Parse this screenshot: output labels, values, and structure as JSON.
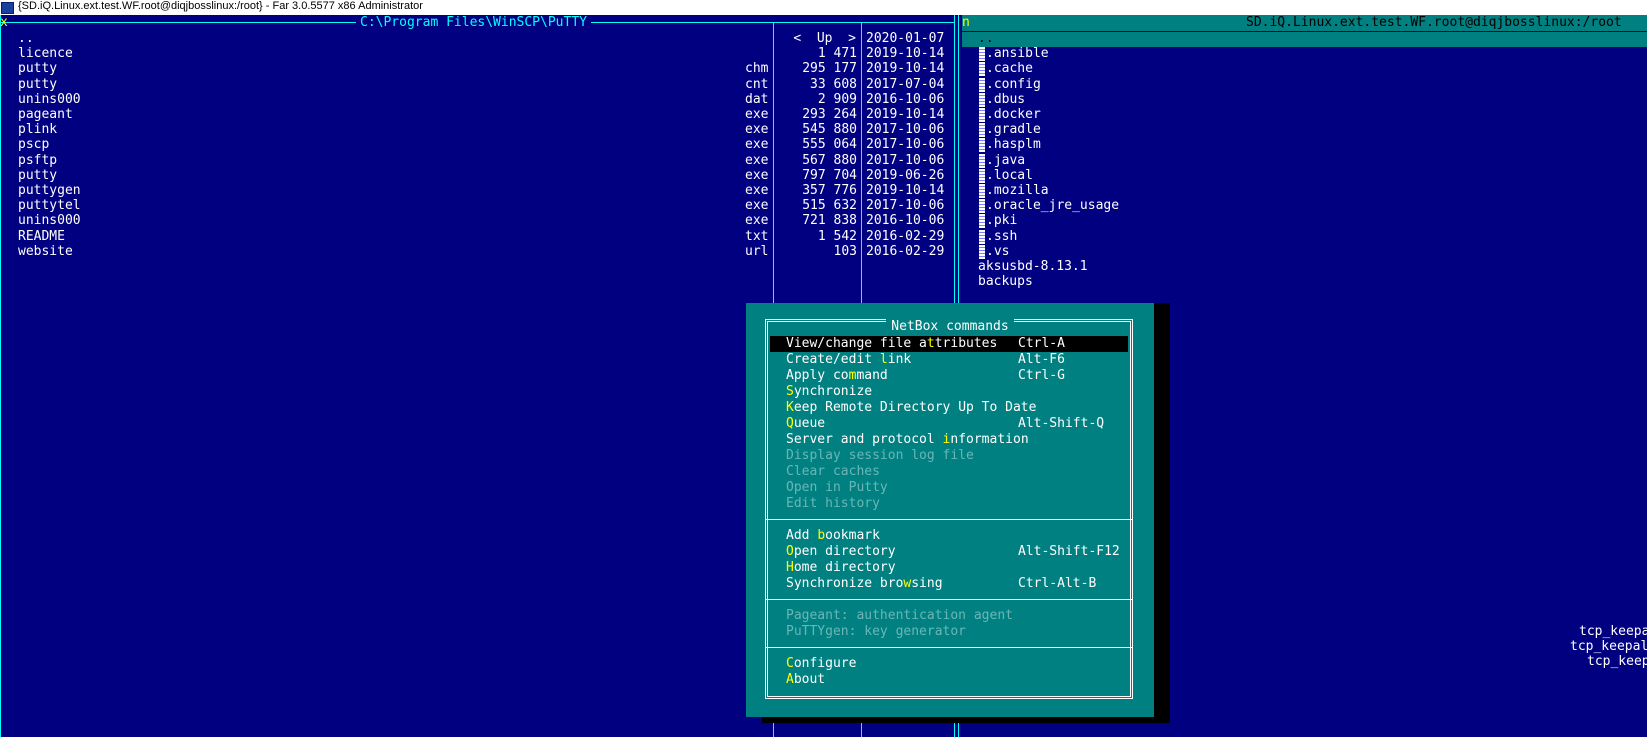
{
  "window": {
    "title": "{SD.iQ.Linux.ext.test.WF.root@diqjbosslinux:/root} - Far 3.0.5577 x86 Administrator"
  },
  "left_panel": {
    "corner_mark": "x",
    "path": "C:\\Program Files\\WinSCP\\PuTTY",
    "up_entry": {
      "name": "..",
      "size": "<  Up  >",
      "date": "2020-01-07"
    },
    "files": [
      {
        "name": "licence",
        "ext": "",
        "size": "1 471",
        "date": "2019-10-14"
      },
      {
        "name": "putty",
        "ext": "chm",
        "size": "295 177",
        "date": "2019-10-14"
      },
      {
        "name": "putty",
        "ext": "cnt",
        "size": "33 608",
        "date": "2017-07-04"
      },
      {
        "name": "unins000",
        "ext": "dat",
        "size": "2 909",
        "date": "2016-10-06"
      },
      {
        "name": "pageant",
        "ext": "exe",
        "size": "293 264",
        "date": "2019-10-14"
      },
      {
        "name": "plink",
        "ext": "exe",
        "size": "545 880",
        "date": "2017-10-06"
      },
      {
        "name": "pscp",
        "ext": "exe",
        "size": "555 064",
        "date": "2017-10-06"
      },
      {
        "name": "psftp",
        "ext": "exe",
        "size": "567 880",
        "date": "2017-10-06"
      },
      {
        "name": "putty",
        "ext": "exe",
        "size": "797 704",
        "date": "2019-06-26"
      },
      {
        "name": "puttygen",
        "ext": "exe",
        "size": "357 776",
        "date": "2019-10-14"
      },
      {
        "name": "puttytel",
        "ext": "exe",
        "size": "515 632",
        "date": "2017-10-06"
      },
      {
        "name": "unins000",
        "ext": "exe",
        "size": "721 838",
        "date": "2016-10-06"
      },
      {
        "name": "README",
        "ext": "txt",
        "size": "1 542",
        "date": "2016-02-29"
      },
      {
        "name": "website",
        "ext": "url",
        "size": "103",
        "date": "2016-02-29"
      }
    ]
  },
  "right_panel": {
    "corner_mark": "n",
    "title": "SD.iQ.Linux.ext.test.WF.root@diqjbosslinux:/root",
    "up_entry": "..",
    "files": [
      {
        "name": ".ansible",
        "dotfile": true
      },
      {
        "name": ".cache",
        "dotfile": true
      },
      {
        "name": ".config",
        "dotfile": true
      },
      {
        "name": ".dbus",
        "dotfile": true
      },
      {
        "name": ".docker",
        "dotfile": true
      },
      {
        "name": ".gradle",
        "dotfile": true
      },
      {
        "name": ".hasplm",
        "dotfile": true
      },
      {
        "name": ".java",
        "dotfile": true
      },
      {
        "name": ".local",
        "dotfile": true
      },
      {
        "name": ".mozilla",
        "dotfile": true
      },
      {
        "name": ".oracle_jre_usage",
        "dotfile": true
      },
      {
        "name": ".pki",
        "dotfile": true
      },
      {
        "name": ".ssh",
        "dotfile": true
      },
      {
        "name": ".vs",
        "dotfile": true
      },
      {
        "name": "aksusbd-8.13.1",
        "dotfile": false
      },
      {
        "name": "backups",
        "dotfile": false
      }
    ],
    "partial_items": [
      "tcp_keepa",
      "tcp_keepal",
      "tcp_keep"
    ]
  },
  "dialog": {
    "title": "NetBox commands",
    "groups": [
      [
        {
          "pre": "View/change file a",
          "hk": "t",
          "post": "tributes",
          "shortcut": "Ctrl-A",
          "selected": true
        },
        {
          "pre": "Create/edit ",
          "hk": "l",
          "post": "ink",
          "shortcut": "Alt-F6"
        },
        {
          "pre": "Apply co",
          "hk": "m",
          "post": "mand",
          "shortcut": "Ctrl-G"
        },
        {
          "pre": "",
          "hk": "S",
          "post": "ynchronize",
          "shortcut": ""
        },
        {
          "pre": "",
          "hk": "K",
          "post": "eep Remote Directory Up To Date",
          "shortcut": ""
        },
        {
          "pre": "",
          "hk": "Q",
          "post": "ueue",
          "shortcut": "Alt-Shift-Q"
        },
        {
          "pre": "Server and protocol ",
          "hk": "i",
          "post": "nformation",
          "shortcut": ""
        },
        {
          "pre": "Display session log file",
          "hk": "",
          "post": "",
          "shortcut": "",
          "disabled": true
        },
        {
          "pre": "Clear caches",
          "hk": "",
          "post": "",
          "shortcut": "",
          "disabled": true
        },
        {
          "pre": "Open in Putty",
          "hk": "",
          "post": "",
          "shortcut": "",
          "disabled": true
        },
        {
          "pre": "Edit history",
          "hk": "",
          "post": "",
          "shortcut": "",
          "disabled": true
        }
      ],
      [
        {
          "pre": "Add ",
          "hk": "b",
          "post": "ookmark",
          "shortcut": ""
        },
        {
          "pre": "",
          "hk": "O",
          "post": "pen directory",
          "shortcut": "Alt-Shift-F12"
        },
        {
          "pre": "",
          "hk": "H",
          "post": "ome directory",
          "shortcut": ""
        },
        {
          "pre": "Synchronize bro",
          "hk": "w",
          "post": "sing",
          "shortcut": "Ctrl-Alt-B"
        }
      ],
      [
        {
          "pre": "Pageant: authentication agent",
          "hk": "",
          "post": "",
          "shortcut": "",
          "disabled": true
        },
        {
          "pre": "PuTTYgen: key generator",
          "hk": "",
          "post": "",
          "shortcut": "",
          "disabled": true
        }
      ],
      [
        {
          "pre": "",
          "hk": "C",
          "post": "onfigure",
          "shortcut": ""
        },
        {
          "pre": "",
          "hk": "A",
          "post": "bout",
          "shortcut": ""
        }
      ]
    ]
  },
  "colors": {
    "background": "#000080",
    "panel_text": "#00ffff",
    "file_text": "#ffffff",
    "dialog_bg": "#008080",
    "hotkey": "#ffff00",
    "disabled": "#6ab6b6"
  }
}
